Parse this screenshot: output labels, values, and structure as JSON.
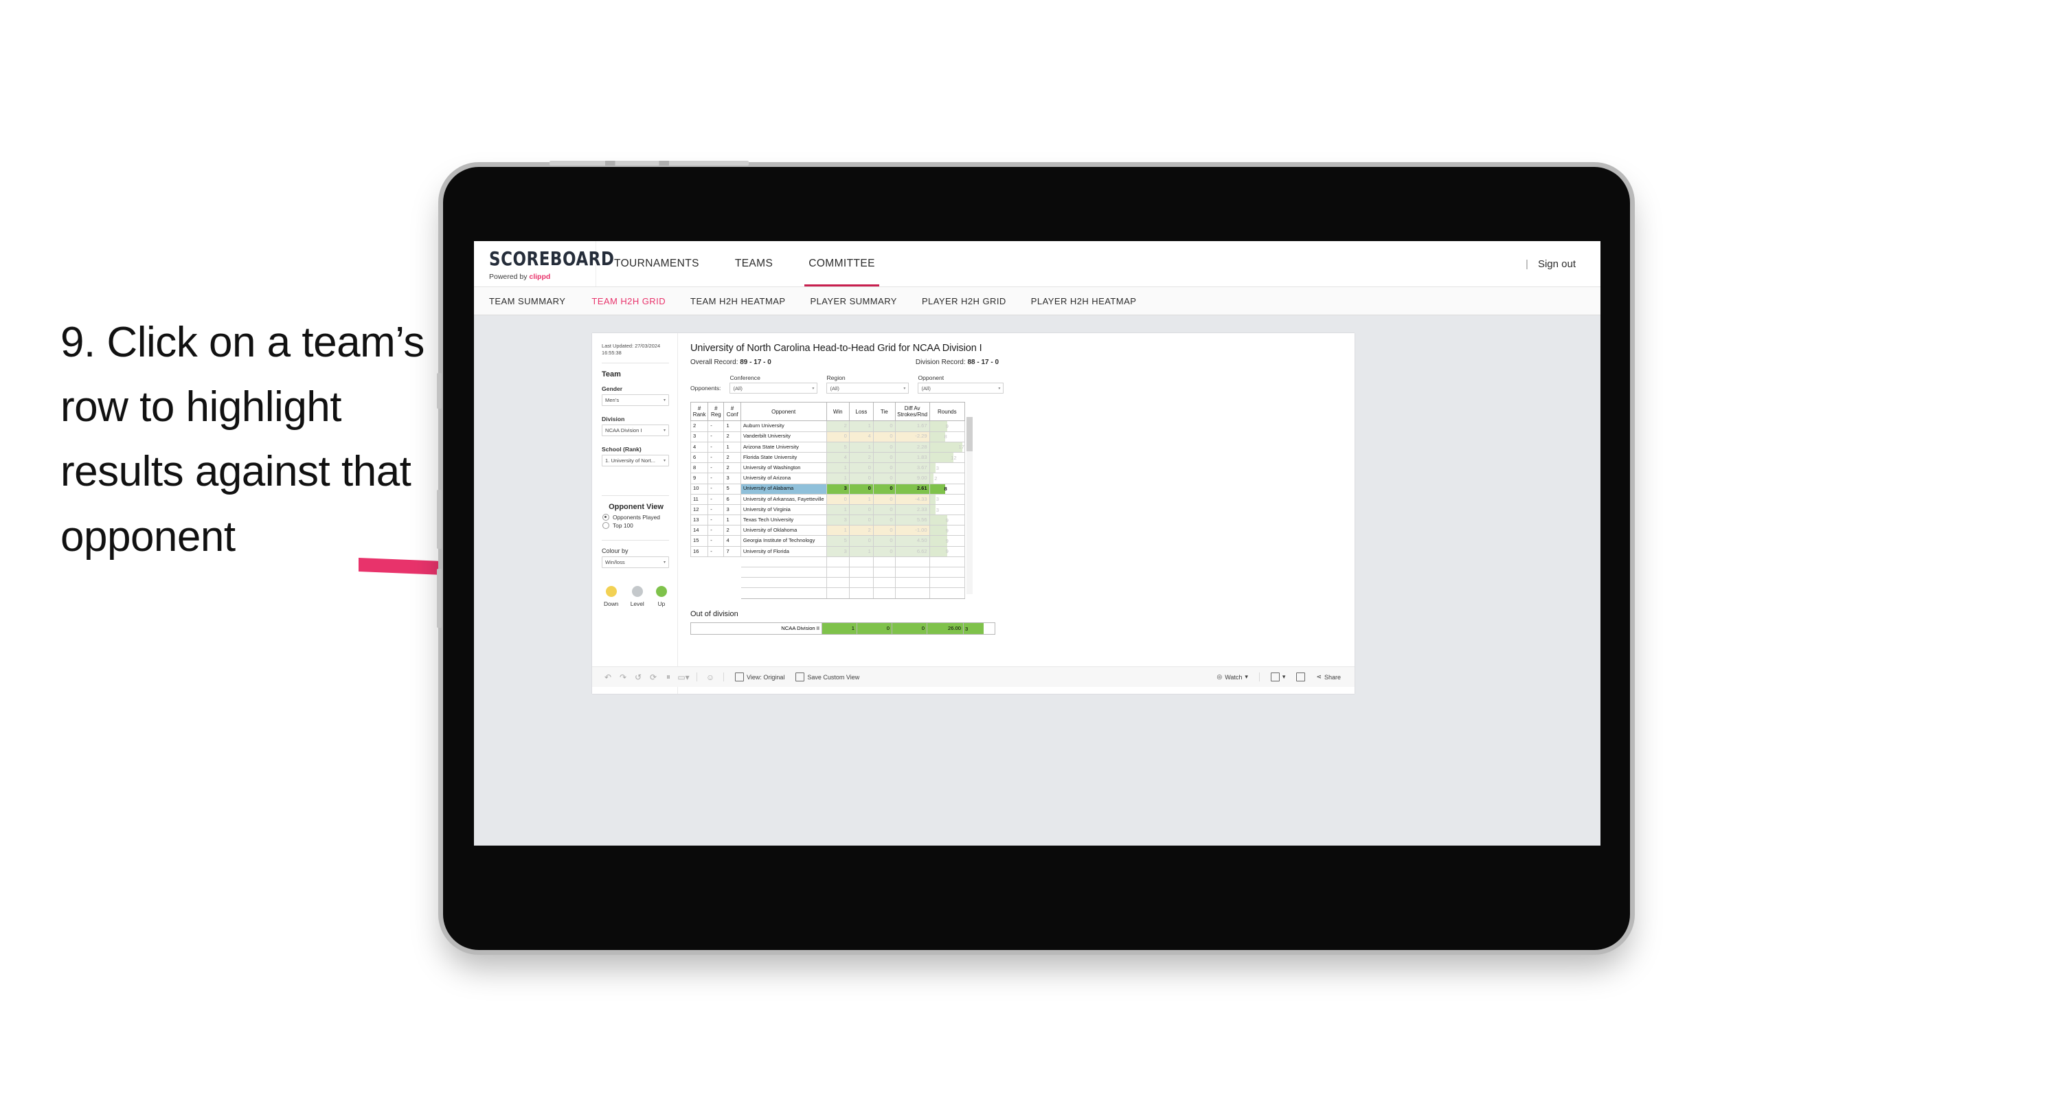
{
  "caption": {
    "text": "9. Click on a team’s row to highlight results against that opponent"
  },
  "header": {
    "brand_title": "SCOREBOARD",
    "brand_powered_prefix": "Powered by ",
    "brand_powered_name": "clippd",
    "nav": [
      {
        "label": "TOURNAMENTS",
        "active": false
      },
      {
        "label": "TEAMS",
        "active": false
      },
      {
        "label": "COMMITTEE",
        "active": true
      }
    ],
    "divider": "|",
    "sign_out": "Sign out",
    "accent_color": "#e8336b",
    "active_underline_color": "#c8204f"
  },
  "subnav": {
    "items": [
      {
        "label": "TEAM SUMMARY",
        "active": false
      },
      {
        "label": "TEAM H2H GRID",
        "active": true
      },
      {
        "label": "TEAM H2H HEATMAP",
        "active": false
      },
      {
        "label": "PLAYER SUMMARY",
        "active": false
      },
      {
        "label": "PLAYER H2H GRID",
        "active": false
      },
      {
        "label": "PLAYER H2H HEATMAP",
        "active": false
      }
    ]
  },
  "sidebar": {
    "last_updated": "Last Updated: 27/03/2024 16:55:38",
    "team_heading": "Team",
    "gender_label": "Gender",
    "gender_value": "Men’s",
    "division_label": "Division",
    "division_value": "NCAA Division I",
    "school_label": "School (Rank)",
    "school_value": "1. University of Nort...",
    "opponent_view_heading": "Opponent View",
    "opponent_view_options": [
      {
        "label": "Opponents Played",
        "selected": true
      },
      {
        "label": "Top 100",
        "selected": false
      }
    ],
    "colour_by_label": "Colour by",
    "colour_by_value": "Win/loss",
    "legend": [
      {
        "label": "Down",
        "color": "#f2d154"
      },
      {
        "label": "Level",
        "color": "#c4c8cb"
      },
      {
        "label": "Up",
        "color": "#7fc24b"
      }
    ]
  },
  "main": {
    "title": "University of North Carolina Head-to-Head Grid for NCAA Division I",
    "overall_record_label": "Overall Record: ",
    "overall_record_value": "89 - 17 - 0",
    "division_record_label": "Division Record: ",
    "division_record_value": "88 - 17 - 0",
    "opponents_label": "Opponents:",
    "filters": [
      {
        "label": "Conference",
        "value": "(All)"
      },
      {
        "label": "Region",
        "value": "(All)"
      },
      {
        "label": "Opponent",
        "value": "(All)"
      }
    ],
    "columns": [
      "# Rank",
      "# Reg",
      "# Conf",
      "Opponent",
      "Win",
      "Loss",
      "Tie",
      "Diff Av Strokes/Rnd",
      "Rounds"
    ],
    "out_of_division_heading": "Out of division",
    "out_of_division_row": {
      "name": "NCAA Division II",
      "win": "1",
      "loss": "0",
      "tie": "0",
      "diff": "26.00",
      "rounds": "3"
    }
  },
  "chart_data": {
    "type": "table",
    "title": "University of North Carolina Head-to-Head Grid for NCAA Division I",
    "columns": [
      "# Rank",
      "# Reg",
      "# Conf",
      "Opponent",
      "Win",
      "Loss",
      "Tie",
      "Diff Av Strokes/Rnd",
      "Rounds"
    ],
    "highlighted_row": "University of Alabama",
    "colour_by": "Win/loss",
    "colour_scale": {
      "down": "#f2d154",
      "level": "#c4c8cb",
      "up": "#7fc24b"
    },
    "rows": [
      {
        "rank": "2",
        "reg": "-",
        "conf": "1",
        "opponent": "Auburn University",
        "win": "2",
        "loss": "1",
        "tie": "0",
        "diff": "1.67",
        "rounds": "9",
        "tone": "up",
        "rounds_pct": 50,
        "highlighted": false
      },
      {
        "rank": "3",
        "reg": "-",
        "conf": "2",
        "opponent": "Vanderbilt University",
        "win": "0",
        "loss": "4",
        "tie": "0",
        "diff": "-2.29",
        "rounds": "8",
        "tone": "down",
        "rounds_pct": 45,
        "highlighted": false
      },
      {
        "rank": "4",
        "reg": "-",
        "conf": "1",
        "opponent": "Arizona State University",
        "win": "5",
        "loss": "1",
        "tie": "0",
        "diff": "2.28",
        "rounds": "17",
        "tone": "up",
        "rounds_pct": 95,
        "highlighted": false
      },
      {
        "rank": "6",
        "reg": "-",
        "conf": "2",
        "opponent": "Florida State University",
        "win": "4",
        "loss": "2",
        "tie": "0",
        "diff": "1.83",
        "rounds": "12",
        "tone": "up",
        "rounds_pct": 68,
        "highlighted": false
      },
      {
        "rank": "8",
        "reg": "-",
        "conf": "2",
        "opponent": "University of Washington",
        "win": "1",
        "loss": "0",
        "tie": "0",
        "diff": "3.67",
        "rounds": "3",
        "tone": "up",
        "rounds_pct": 17,
        "highlighted": false
      },
      {
        "rank": "9",
        "reg": "-",
        "conf": "3",
        "opponent": "University of Arizona",
        "win": "1",
        "loss": "0",
        "tie": "0",
        "diff": "9.00",
        "rounds": "2",
        "tone": "up",
        "rounds_pct": 11,
        "highlighted": false
      },
      {
        "rank": "10",
        "reg": "-",
        "conf": "5",
        "opponent": "University of Alabama",
        "win": "3",
        "loss": "0",
        "tie": "0",
        "diff": "2.61",
        "rounds": "8",
        "tone": "up",
        "rounds_pct": 45,
        "highlighted": true
      },
      {
        "rank": "11",
        "reg": "-",
        "conf": "6",
        "opponent": "University of Arkansas, Fayetteville",
        "win": "0",
        "loss": "1",
        "tie": "0",
        "diff": "-4.33",
        "rounds": "3",
        "tone": "down",
        "rounds_pct": 17,
        "highlighted": false
      },
      {
        "rank": "12",
        "reg": "-",
        "conf": "3",
        "opponent": "University of Virginia",
        "win": "1",
        "loss": "0",
        "tie": "0",
        "diff": "2.33",
        "rounds": "3",
        "tone": "up",
        "rounds_pct": 17,
        "highlighted": false
      },
      {
        "rank": "13",
        "reg": "-",
        "conf": "1",
        "opponent": "Texas Tech University",
        "win": "3",
        "loss": "0",
        "tie": "0",
        "diff": "5.56",
        "rounds": "9",
        "tone": "up",
        "rounds_pct": 50,
        "highlighted": false
      },
      {
        "rank": "14",
        "reg": "-",
        "conf": "2",
        "opponent": "University of Oklahoma",
        "win": "1",
        "loss": "2",
        "tie": "0",
        "diff": "-1.00",
        "rounds": "9",
        "tone": "down",
        "rounds_pct": 50,
        "highlighted": false
      },
      {
        "rank": "15",
        "reg": "-",
        "conf": "4",
        "opponent": "Georgia Institute of Technology",
        "win": "5",
        "loss": "0",
        "tie": "0",
        "diff": "4.50",
        "rounds": "9",
        "tone": "up",
        "rounds_pct": 50,
        "highlighted": false
      },
      {
        "rank": "16",
        "reg": "-",
        "conf": "7",
        "opponent": "University of Florida",
        "win": "3",
        "loss": "1",
        "tie": "0",
        "diff": "6.62",
        "rounds": "9",
        "tone": "up",
        "rounds_pct": 50,
        "highlighted": false
      }
    ],
    "out_of_division": [
      {
        "name": "NCAA Division II",
        "win": "1",
        "loss": "0",
        "tie": "0",
        "diff": "26.00",
        "rounds": "3"
      }
    ]
  },
  "toolbar": {
    "view_label": "View: Original",
    "save_label": "Save Custom View",
    "watch_label": "Watch",
    "share_label": "Share"
  }
}
